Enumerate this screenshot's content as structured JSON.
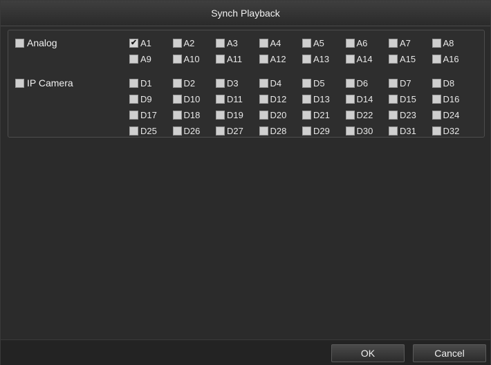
{
  "window": {
    "title": "Synch Playback"
  },
  "analog": {
    "label": "Analog",
    "checked": false,
    "channels": [
      {
        "label": "A1",
        "checked": true
      },
      {
        "label": "A2",
        "checked": false
      },
      {
        "label": "A3",
        "checked": false
      },
      {
        "label": "A4",
        "checked": false
      },
      {
        "label": "A5",
        "checked": false
      },
      {
        "label": "A6",
        "checked": false
      },
      {
        "label": "A7",
        "checked": false
      },
      {
        "label": "A8",
        "checked": false
      },
      {
        "label": "A9",
        "checked": false
      },
      {
        "label": "A10",
        "checked": false
      },
      {
        "label": "A11",
        "checked": false
      },
      {
        "label": "A12",
        "checked": false
      },
      {
        "label": "A13",
        "checked": false
      },
      {
        "label": "A14",
        "checked": false
      },
      {
        "label": "A15",
        "checked": false
      },
      {
        "label": "A16",
        "checked": false
      }
    ]
  },
  "ip_camera": {
    "label": "IP Camera",
    "checked": false,
    "channels": [
      {
        "label": "D1",
        "checked": false
      },
      {
        "label": "D2",
        "checked": false
      },
      {
        "label": "D3",
        "checked": false
      },
      {
        "label": "D4",
        "checked": false
      },
      {
        "label": "D5",
        "checked": false
      },
      {
        "label": "D6",
        "checked": false
      },
      {
        "label": "D7",
        "checked": false
      },
      {
        "label": "D8",
        "checked": false
      },
      {
        "label": "D9",
        "checked": false
      },
      {
        "label": "D10",
        "checked": false
      },
      {
        "label": "D11",
        "checked": false
      },
      {
        "label": "D12",
        "checked": false
      },
      {
        "label": "D13",
        "checked": false
      },
      {
        "label": "D14",
        "checked": false
      },
      {
        "label": "D15",
        "checked": false
      },
      {
        "label": "D16",
        "checked": false
      },
      {
        "label": "D17",
        "checked": false
      },
      {
        "label": "D18",
        "checked": false
      },
      {
        "label": "D19",
        "checked": false
      },
      {
        "label": "D20",
        "checked": false
      },
      {
        "label": "D21",
        "checked": false
      },
      {
        "label": "D22",
        "checked": false
      },
      {
        "label": "D23",
        "checked": false
      },
      {
        "label": "D24",
        "checked": false
      },
      {
        "label": "D25",
        "checked": false
      },
      {
        "label": "D26",
        "checked": false
      },
      {
        "label": "D27",
        "checked": false
      },
      {
        "label": "D28",
        "checked": false
      },
      {
        "label": "D29",
        "checked": false
      },
      {
        "label": "D30",
        "checked": false
      },
      {
        "label": "D31",
        "checked": false
      },
      {
        "label": "D32",
        "checked": false
      }
    ]
  },
  "footer": {
    "ok_label": "OK",
    "cancel_label": "Cancel"
  }
}
